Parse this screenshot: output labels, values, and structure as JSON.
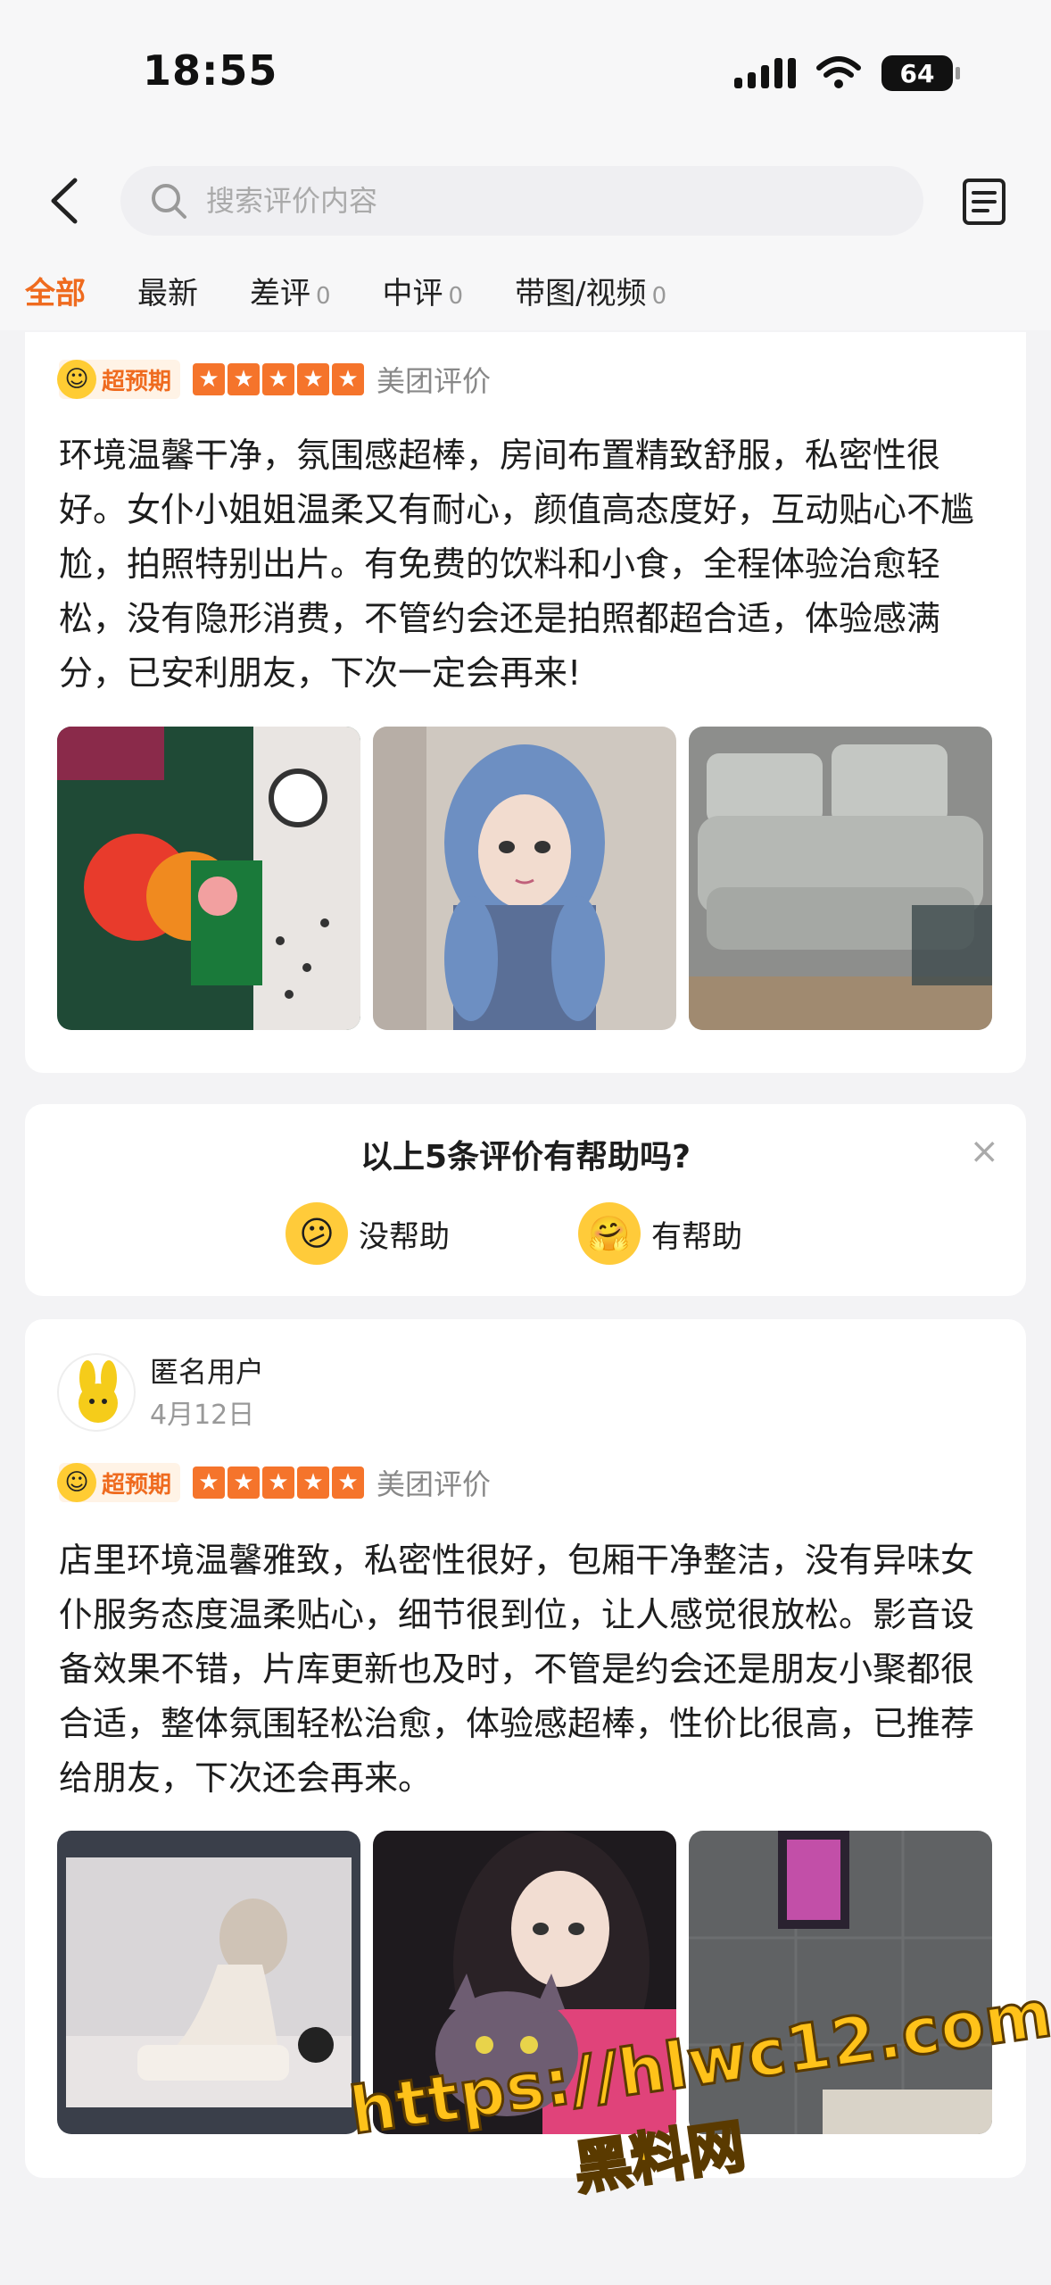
{
  "status_bar": {
    "time": "18:55",
    "battery": "64"
  },
  "search": {
    "placeholder": "搜索评价内容"
  },
  "tabs": [
    {
      "label": "全部",
      "count": ""
    },
    {
      "label": "最新",
      "count": ""
    },
    {
      "label": "差评",
      "count": "0"
    },
    {
      "label": "中评",
      "count": "0"
    },
    {
      "label": "带图/视频",
      "count": "0"
    }
  ],
  "reviews": [
    {
      "badge": "超预期",
      "source": "美团评价",
      "text": "环境温馨干净，氛围感超棒，房间布置精致舒服，私密性很好。女仆小姐姐温柔又有耐心，颜值高态度好，互动贴心不尴尬，拍照特别出片。有免费的饮料和小食，全程体验治愈轻松，没有隐形消费，不管约会还是拍照都超合适，体验感满分，已安利朋友，下次一定会再来!"
    },
    {
      "user": "匿名用户",
      "date": "4月12日",
      "badge": "超预期",
      "source": "美团评价",
      "text": "店里环境温馨雅致，私密性很好，包厢干净整洁，没有异味女仆服务态度温柔贴心，细节很到位，让人感觉很放松。影音设备效果不错，片库更新也及时，不管是约会还是朋友小聚都很合适，整体氛围轻松治愈，体验感超棒，性价比很高，已推荐给朋友，下次还会再来。"
    }
  ],
  "helpful": {
    "question": "以上5条评价有帮助吗?",
    "no": "没帮助",
    "yes": "有帮助"
  },
  "watermark": {
    "url": "https://hlwc12.com",
    "name": "黑料网"
  }
}
